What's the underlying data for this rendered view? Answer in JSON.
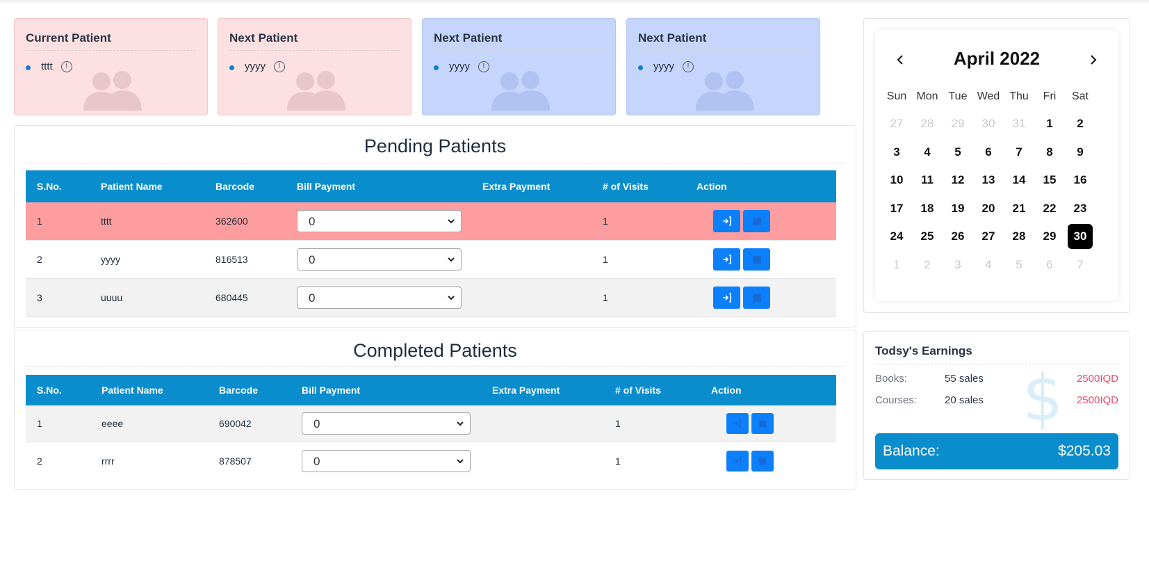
{
  "cards": [
    {
      "title": "Current Patient",
      "patient": "tttt",
      "color": "#fde0e1"
    },
    {
      "title": "Next Patient",
      "patient": "yyyy",
      "color": "#fde0e1"
    },
    {
      "title": "Next Patient",
      "patient": "yyyy",
      "color": "#c6d5fb"
    },
    {
      "title": "Next Patient",
      "patient": "yyyy",
      "color": "#c6d5fb"
    }
  ],
  "pending": {
    "title": "Pending Patients",
    "headers": {
      "sno": "S.No.",
      "name": "Patient Name",
      "barcode": "Barcode",
      "bill": "Bill Payment",
      "extra": "Extra Payment",
      "visits": "# of Visits",
      "action": "Action"
    },
    "rows": [
      {
        "sno": "1",
        "name": "tttt",
        "barcode": "362600",
        "bill": "0",
        "extra": "",
        "visits": "1"
      },
      {
        "sno": "2",
        "name": "yyyy",
        "barcode": "816513",
        "bill": "0",
        "extra": "",
        "visits": "1"
      },
      {
        "sno": "3",
        "name": "uuuu",
        "barcode": "680445",
        "bill": "0",
        "extra": "",
        "visits": "1"
      }
    ]
  },
  "completed": {
    "title": "Completed Patients",
    "headers": {
      "sno": "S.No.",
      "name": "Patient Name",
      "barcode": "Barcode",
      "bill": "Bill Payment",
      "extra": "Extra Payment",
      "visits": "# of Visits",
      "action": "Action"
    },
    "rows": [
      {
        "sno": "1",
        "name": "eeee",
        "barcode": "690042",
        "bill": "0",
        "extra": "",
        "visits": "1"
      },
      {
        "sno": "2",
        "name": "rrrr",
        "barcode": "878507",
        "bill": "0",
        "extra": "",
        "visits": "1"
      }
    ]
  },
  "calendar": {
    "title": "April 2022",
    "days_of_week": [
      "Sun",
      "Mon",
      "Tue",
      "Wed",
      "Thu",
      "Fri",
      "Sat"
    ],
    "weeks": [
      [
        "27",
        "28",
        "29",
        "30",
        "31",
        "1",
        "2"
      ],
      [
        "3",
        "4",
        "5",
        "6",
        "7",
        "8",
        "9"
      ],
      [
        "10",
        "11",
        "12",
        "13",
        "14",
        "15",
        "16"
      ],
      [
        "17",
        "18",
        "19",
        "20",
        "21",
        "22",
        "23"
      ],
      [
        "24",
        "25",
        "26",
        "27",
        "28",
        "29",
        "30"
      ],
      [
        "1",
        "2",
        "3",
        "4",
        "5",
        "6",
        "7"
      ]
    ],
    "selected": "30"
  },
  "earnings": {
    "title": "Todsy's Earnings",
    "rows": [
      {
        "label": "Books:",
        "count": "55 sales",
        "amount": "2500IQD"
      },
      {
        "label": "Courses:",
        "count": "20 sales",
        "amount": "2500IQD"
      }
    ],
    "balance_label": "Balance:",
    "balance_value": "$205.03"
  },
  "colors": {
    "accent": "#0a8dcd",
    "button": "#0c7ffb",
    "current_row": "#fe9d9f",
    "amount": "#ef4869"
  }
}
